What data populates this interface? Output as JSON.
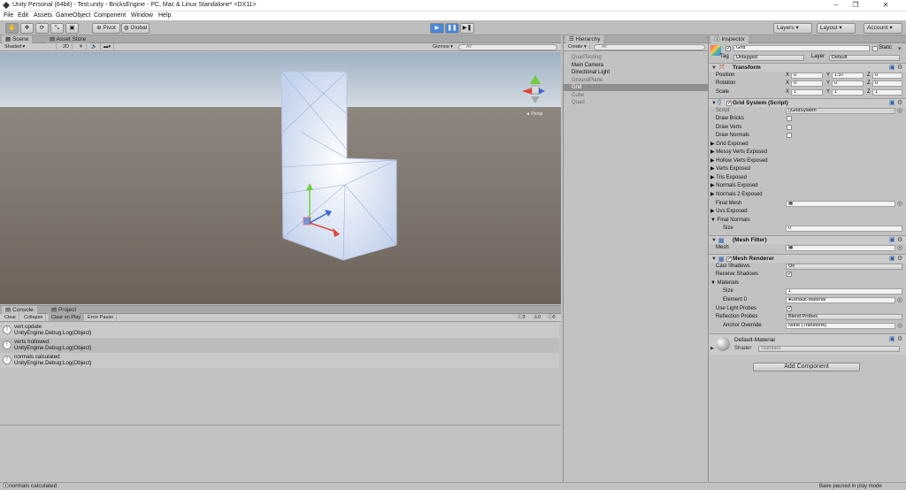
{
  "window": {
    "title": "Unity Personal (64bit) - Test.unity - BricksEngine - PC, Mac & Linux Standalone* <DX11>",
    "minimize": "–",
    "maximize": "❐",
    "close": "✕"
  },
  "menu": [
    "File",
    "Edit",
    "Assets",
    "GameObject",
    "Component",
    "Window",
    "Help"
  ],
  "toolbar": {
    "pivot": "Pivot",
    "global": "Global",
    "layers": "Layers",
    "layout": "Layout",
    "account": "Account"
  },
  "scene": {
    "tabs": [
      "Scene",
      "Asset Store"
    ],
    "shading": "Shaded",
    "mode2d": "2D",
    "gizmos": "Gizmos ▾",
    "search": "All",
    "persp": "◄ Persp"
  },
  "console": {
    "tabs": [
      "Console",
      "Project"
    ],
    "buttons": [
      "Clear",
      "Collapse",
      "Clear on Play",
      "Error Pause"
    ],
    "counts": {
      "info": "3",
      "warn": "0",
      "error": "0"
    },
    "entries": [
      {
        "line1": "vert update",
        "line2": "UnityEngine.Debug:Log(Object)"
      },
      {
        "line1": "verts hollowed",
        "line2": "UnityEngine.Debug:Log(Object)"
      },
      {
        "line1": "normals calculated",
        "line2": "UnityEngine.Debug:Log(Object)"
      }
    ]
  },
  "hierarchy": {
    "tab": "Hierarchy",
    "create": "Create ▾",
    "search": "All",
    "items": [
      {
        "label": "QuadTesting",
        "state": "dim"
      },
      {
        "label": "Main Camera",
        "state": "normal"
      },
      {
        "label": "Directional Light",
        "state": "normal"
      },
      {
        "label": "GroundPlane",
        "state": "dim"
      },
      {
        "label": "Grid",
        "state": "sel"
      },
      {
        "label": "Cube",
        "state": "dim"
      },
      {
        "label": "Quad",
        "state": "dim"
      }
    ]
  },
  "inspector": {
    "tab": "Inspector",
    "object_name": "Grid",
    "static": "Static",
    "tag_label": "Tag",
    "tag": "Untagged",
    "layer_label": "Layer",
    "layer": "Default",
    "transform": {
      "title": "Transform",
      "rows": [
        {
          "label": "Position",
          "x": "0",
          "y": "1.97",
          "z": "0"
        },
        {
          "label": "Rotation",
          "x": "0",
          "y": "0",
          "z": "0"
        },
        {
          "label": "Scale",
          "x": "1",
          "y": "1",
          "z": "1"
        }
      ]
    },
    "grid_system": {
      "title": "Grid System (Script)",
      "script_label": "Script",
      "script": "GridSystem",
      "draw_bricks": "Draw Bricks",
      "draw_verts": "Draw Verts",
      "draw_normals": "Draw Normals",
      "foldouts": [
        "Grid Exposed",
        "Messy Verts Exposed",
        "Hollow Verts Exposed",
        "Verts Exposed",
        "Tris Exposed",
        "Normals Exposed",
        "Normals 2 Exposed"
      ],
      "final_mesh": "Final Mesh",
      "uvs": "Uvs Exposed",
      "final_normals": "Final Normals",
      "size_label": "Size",
      "size": "0"
    },
    "mesh_filter": {
      "title": "(Mesh Filter)",
      "mesh_label": "Mesh"
    },
    "mesh_renderer": {
      "title": "Mesh Renderer",
      "cast_shadows_label": "Cast Shadows",
      "cast_shadows": "On",
      "receive_shadows": "Receive Shadows",
      "materials": "Materials",
      "size_label": "Size",
      "size": "1",
      "element0_label": "Element 0",
      "element0": "Default-Material",
      "light_probes": "Use Light Probes",
      "reflection_label": "Reflection Probes",
      "reflection": "Blend Probes",
      "anchor_label": "Anchor Override",
      "anchor": "None (Transform)"
    },
    "material": {
      "name": "Default-Material",
      "shader_label": "Shader",
      "shader": "Standard"
    },
    "add_component": "Add Component"
  },
  "status": {
    "left": "normals calculated",
    "right": "Bake paused in play mode"
  },
  "colors": {
    "sky": "#b8c7d6",
    "ground": "#766b61",
    "accent": "#3d7bd4",
    "selection": "#8e8e8e"
  }
}
